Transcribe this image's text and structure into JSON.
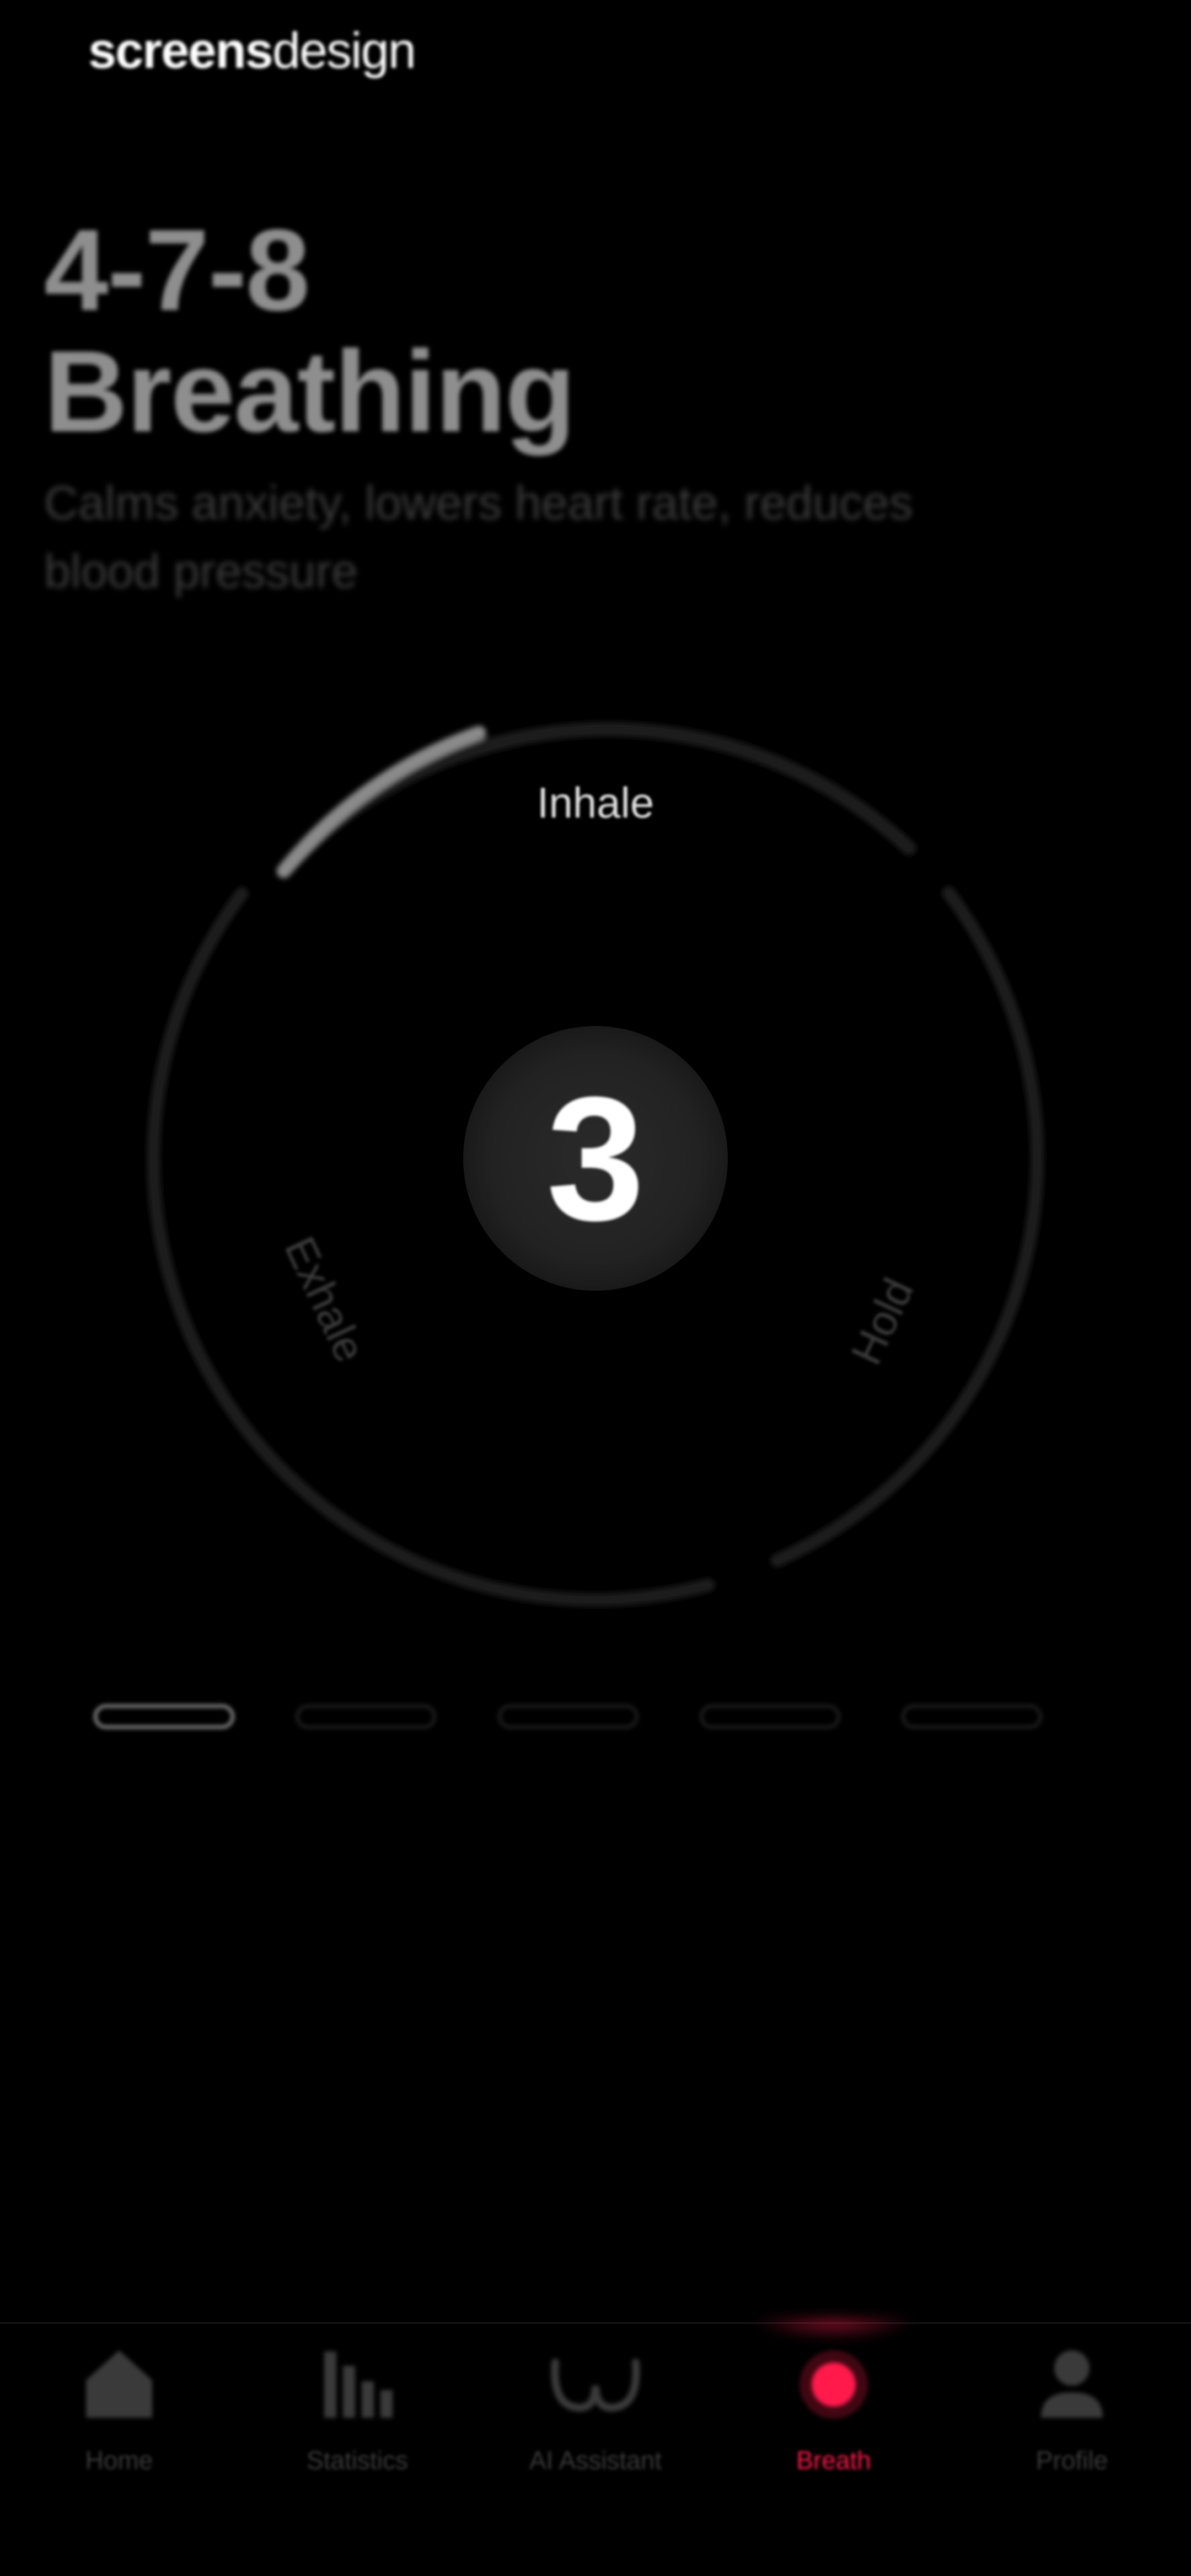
{
  "brand": {
    "part1": "screens",
    "part2": "design"
  },
  "exercise": {
    "title_line1": "4-7-8",
    "title_line2": "Breathing",
    "subtitle": "Calms anxiety, lowers heart rate, reduces blood pressure"
  },
  "breath_circle": {
    "phases": {
      "inhale": "Inhale",
      "hold": "Hold",
      "exhale": "Exhale"
    },
    "active_phase": "inhale",
    "counter": "3"
  },
  "pager": {
    "count": 5,
    "active_index": 0
  },
  "tab_bar": {
    "items": [
      {
        "label": "Home",
        "icon": "home-icon"
      },
      {
        "label": "Statistics",
        "icon": "statistics-icon"
      },
      {
        "label": "AI Assistant",
        "icon": "ai-assistant-icon"
      },
      {
        "label": "Breath",
        "icon": "breath-icon"
      },
      {
        "label": "Profile",
        "icon": "profile-icon"
      }
    ],
    "active_index": 3
  },
  "colors": {
    "background": "#000000",
    "accent": "#ff1a4b",
    "ring_track": "#1c1c1c",
    "ring_progress": "#8a8a8a",
    "inactive": "#3a3a3a"
  }
}
